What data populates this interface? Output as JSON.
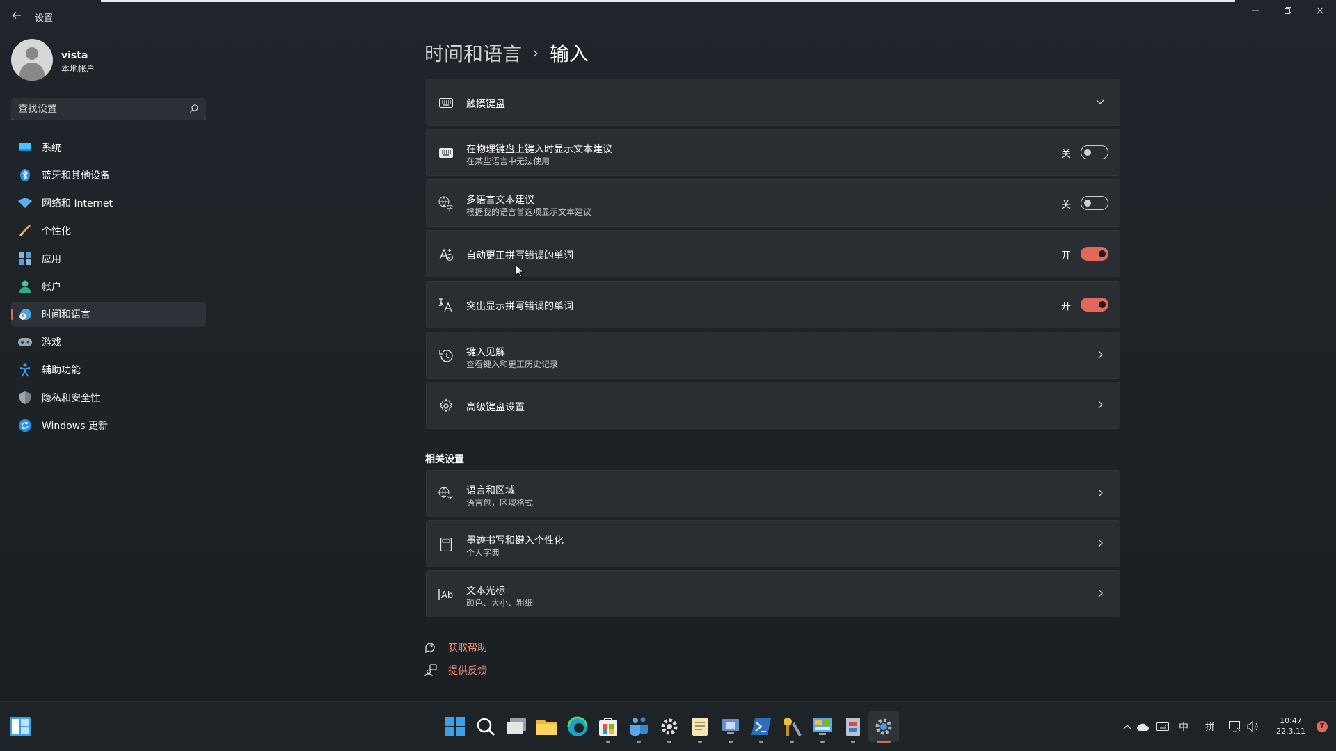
{
  "app": {
    "title": "设置"
  },
  "user": {
    "name": "vista",
    "account_type": "本地帐户"
  },
  "search": {
    "placeholder": "查找设置"
  },
  "colors": {
    "accent": "#e2685b",
    "link": "#f08c7b",
    "background": "#1c2128",
    "card": "#2a2e33"
  },
  "sidebar": {
    "items": [
      {
        "label": "系统",
        "icon": "monitor-icon"
      },
      {
        "label": "蓝牙和其他设备",
        "icon": "bluetooth-icon"
      },
      {
        "label": "网络和 Internet",
        "icon": "wifi-icon"
      },
      {
        "label": "个性化",
        "icon": "brush-icon"
      },
      {
        "label": "应用",
        "icon": "apps-icon"
      },
      {
        "label": "帐户",
        "icon": "person-icon"
      },
      {
        "label": "时间和语言",
        "icon": "clock-globe-icon",
        "active": true
      },
      {
        "label": "游戏",
        "icon": "gamepad-icon"
      },
      {
        "label": "辅助功能",
        "icon": "accessibility-icon"
      },
      {
        "label": "隐私和安全性",
        "icon": "shield-icon"
      },
      {
        "label": "Windows 更新",
        "icon": "update-icon"
      }
    ]
  },
  "breadcrumb": {
    "parent": "时间和语言",
    "separator": "›",
    "current": "输入"
  },
  "settings": [
    {
      "title": "触摸键盘",
      "icon": "keyboard-icon",
      "control": "expand"
    },
    {
      "title": "在物理键盘上键入时显示文本建议",
      "subtitle": "在某些语言中无法使用",
      "icon": "keyboard-icon",
      "state": "关",
      "on": false
    },
    {
      "title": "多语言文本建议",
      "subtitle": "根据我的语言首选项显示文本建议",
      "icon": "language-icon",
      "state": "关",
      "on": false
    },
    {
      "title": "自动更正拼写错误的单词",
      "icon": "spellcheck-auto-icon",
      "state": "开",
      "on": true
    },
    {
      "title": "突出显示拼写错误的单词",
      "icon": "spellcheck-highlight-icon",
      "state": "开",
      "on": true
    },
    {
      "title": "键入见解",
      "subtitle": "查看键入和更正历史记录",
      "icon": "history-icon",
      "control": "chevron"
    },
    {
      "title": "高级键盘设置",
      "icon": "gear-icon",
      "control": "chevron"
    }
  ],
  "related": {
    "title": "相关设置",
    "items": [
      {
        "title": "语言和区域",
        "subtitle": "语言包，区域格式",
        "icon": "language-icon"
      },
      {
        "title": "墨迹书写和键入个性化",
        "subtitle": "个人字典",
        "icon": "notebook-icon"
      },
      {
        "title": "文本光标",
        "subtitle": "颜色、大小、粗细",
        "icon": "text-cursor-icon"
      }
    ]
  },
  "help": {
    "get_help": "获取帮助",
    "feedback": "提供反馈"
  },
  "taskbar": {
    "apps": [
      "windows-start-icon",
      "search-icon",
      "task-view-icon",
      "file-explorer-icon",
      "edge-icon",
      "store-icon",
      "teams-icon",
      "settings-gear-icon",
      "notepad-icon",
      "remote-desktop-icon",
      "powershell-icon",
      "tools-icon",
      "control-panel-icon",
      "registry-icon",
      "settings-icon"
    ],
    "tray": {
      "chevron": "^",
      "ime_lang": "中",
      "ime_mode": "拼"
    },
    "time": "10:47",
    "date": "22.3.11",
    "notification_count": "7"
  }
}
